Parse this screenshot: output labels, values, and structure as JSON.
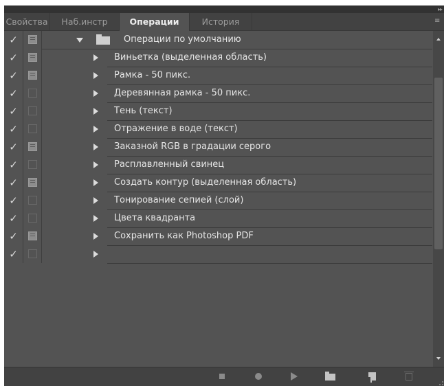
{
  "tabs": [
    {
      "label": "Свойства"
    },
    {
      "label": "Наб.инстр"
    },
    {
      "label": "Операции"
    },
    {
      "label": "История"
    }
  ],
  "active_tab": "Операции",
  "icons": {
    "check": "✓",
    "collapse": "▸▸",
    "panel_menu": "≡"
  },
  "action_set": {
    "name": "Операции по умолчанию",
    "enabled": true,
    "dialog": true,
    "expanded": true
  },
  "actions": [
    {
      "label": "Виньетка (выделенная область)",
      "enabled": true,
      "dialog": true
    },
    {
      "label": "Рамка - 50 пикс.",
      "enabled": true,
      "dialog": true
    },
    {
      "label": "Деревянная рамка - 50 пикс.",
      "enabled": true,
      "dialog": false
    },
    {
      "label": "Тень (текст)",
      "enabled": true,
      "dialog": false
    },
    {
      "label": "Отражение в воде (текст)",
      "enabled": true,
      "dialog": false
    },
    {
      "label": "Заказной RGB в градации серого",
      "enabled": true,
      "dialog": true
    },
    {
      "label": "Расплавленный свинец",
      "enabled": true,
      "dialog": false
    },
    {
      "label": "Создать контур (выделенная область)",
      "enabled": true,
      "dialog": true
    },
    {
      "label": "Тонирование сепией (слой)",
      "enabled": true,
      "dialog": false
    },
    {
      "label": "Цвета квадранта",
      "enabled": true,
      "dialog": false
    },
    {
      "label": "Сохранить как Photoshop PDF",
      "enabled": true,
      "dialog": true
    },
    {
      "label": "",
      "enabled": true,
      "dialog": false
    }
  ],
  "footer_buttons": [
    {
      "name": "stop-button",
      "icon": "stop-icon",
      "enabled": false
    },
    {
      "name": "record-button",
      "icon": "record-icon",
      "enabled": false
    },
    {
      "name": "play-button",
      "icon": "play-icon",
      "enabled": false
    },
    {
      "name": "new-set-button",
      "icon": "folder-icon",
      "enabled": true
    },
    {
      "name": "new-action-button",
      "icon": "new-item-icon",
      "enabled": true
    },
    {
      "name": "delete-button",
      "icon": "trash-icon",
      "enabled": false
    }
  ],
  "colors": {
    "panel_bg": "#535353",
    "tab_bar_bg": "#424242",
    "text": "#e6e6e6",
    "tab_text_inactive": "#9c9c9c"
  }
}
